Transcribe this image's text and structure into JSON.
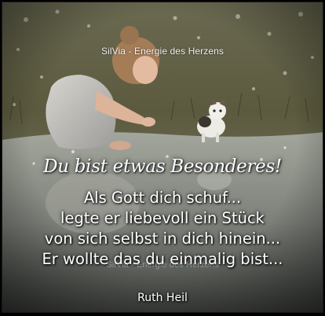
{
  "image": {
    "watermark_top": "SilVia - Energie des Herzens",
    "watermark_bottom": "SilVia - Energie des Herzens",
    "headline": "Du bist etwas Besonderes!",
    "poem_lines": [
      "Als Gott dich schuf...",
      "legte er liebevoll ein Stück",
      "von sich selbst in dich hinein...",
      "Er wollte das du einmalig bist..."
    ],
    "author": "Ruth Heil"
  },
  "colors": {
    "frame": "#000000",
    "grass": "#5c5a3a",
    "water": "#8d9086",
    "dress": "#c9c7c2",
    "skin": "#e0b79d",
    "hair": "#a47d57",
    "text": "#ffffff"
  },
  "icons": {
    "girl": "child-figure",
    "kitten": "kitten-figure"
  }
}
